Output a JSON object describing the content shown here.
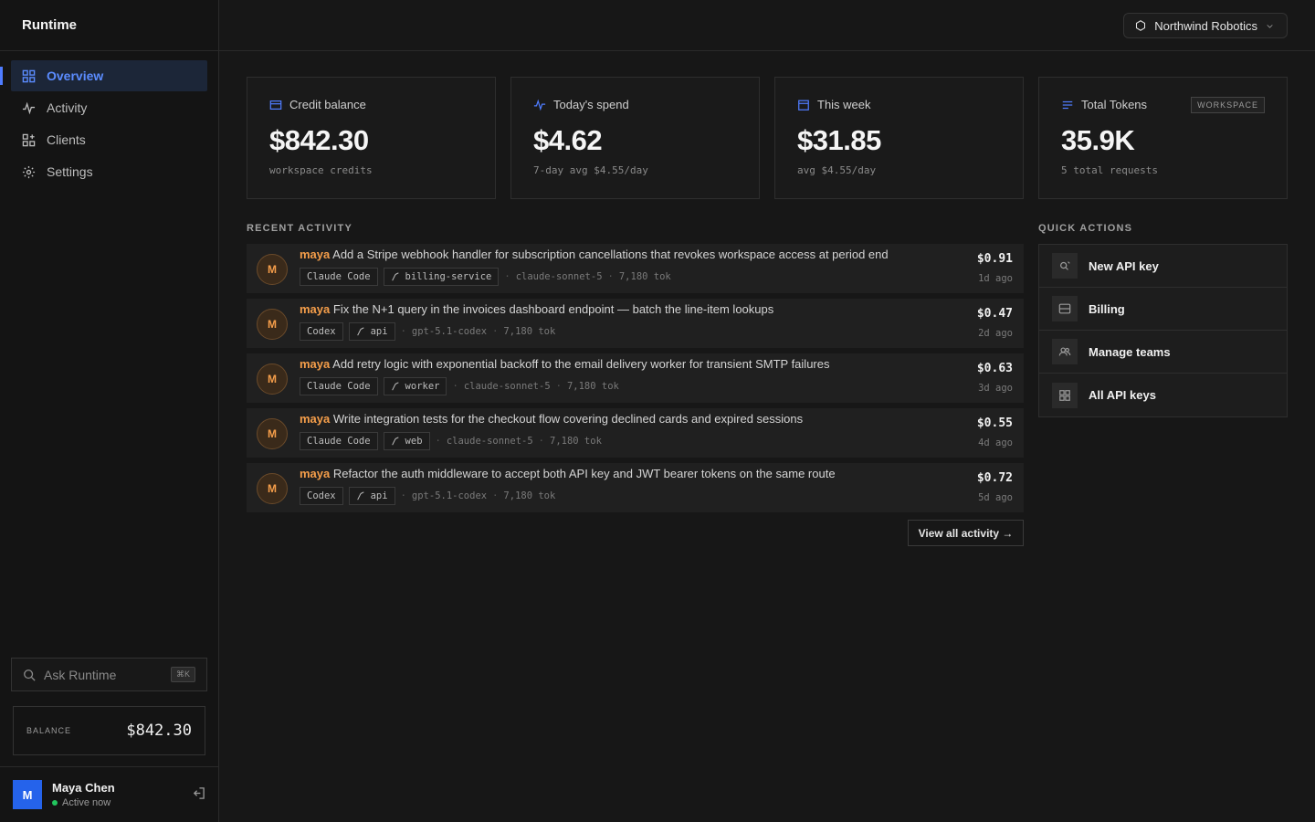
{
  "brand": "Runtime",
  "nav": [
    {
      "label": "Overview",
      "icon": "grid-icon",
      "active": true
    },
    {
      "label": "Activity",
      "icon": "pulse-icon",
      "active": false
    },
    {
      "label": "Clients",
      "icon": "apps-icon",
      "active": false
    },
    {
      "label": "Settings",
      "icon": "gear-icon",
      "active": false
    }
  ],
  "ask": {
    "label": "Ask Runtime",
    "shortcut": "⌘K"
  },
  "sidebar_balance": {
    "label": "BALANCE",
    "value": "$842.30"
  },
  "user": {
    "name": "Maya Chen",
    "initial": "M",
    "status": "Active now"
  },
  "org": {
    "name": "Northwind Robotics"
  },
  "cards": [
    {
      "title": "Credit balance",
      "value": "$842.30",
      "sub": "workspace credits"
    },
    {
      "title": "Today's spend",
      "value": "$4.62",
      "sub": "7-day avg $4.55/day"
    },
    {
      "title": "This week",
      "value": "$31.85",
      "sub": "avg $4.55/day"
    },
    {
      "title": "Total Tokens",
      "value": "35.9K",
      "sub": "5 total requests",
      "badge": "WORKSPACE"
    }
  ],
  "recent_activity_title": "RECENT ACTIVITY",
  "activity": [
    {
      "initial": "M",
      "user": "maya",
      "text": "Add a Stripe webhook handler for subscription cancellations that revokes workspace access at period end",
      "client": "Claude Code",
      "repo": "billing-service",
      "model": "claude-sonnet-5",
      "tokens": "7,180 tok",
      "cost": "$0.91",
      "ago": "1d ago"
    },
    {
      "initial": "M",
      "user": "maya",
      "text": "Fix the N+1 query in the invoices dashboard endpoint — batch the line-item lookups",
      "client": "Codex",
      "repo": "api",
      "model": "gpt-5.1-codex",
      "tokens": "7,180 tok",
      "cost": "$0.47",
      "ago": "2d ago"
    },
    {
      "initial": "M",
      "user": "maya",
      "text": "Add retry logic with exponential backoff to the email delivery worker for transient SMTP failures",
      "client": "Claude Code",
      "repo": "worker",
      "model": "claude-sonnet-5",
      "tokens": "7,180 tok",
      "cost": "$0.63",
      "ago": "3d ago"
    },
    {
      "initial": "M",
      "user": "maya",
      "text": "Write integration tests for the checkout flow covering declined cards and expired sessions",
      "client": "Claude Code",
      "repo": "web",
      "model": "claude-sonnet-5",
      "tokens": "7,180 tok",
      "cost": "$0.55",
      "ago": "4d ago"
    },
    {
      "initial": "M",
      "user": "maya",
      "text": "Refactor the auth middleware to accept both API key and JWT bearer tokens on the same route",
      "client": "Codex",
      "repo": "api",
      "model": "gpt-5.1-codex",
      "tokens": "7,180 tok",
      "cost": "$0.72",
      "ago": "5d ago"
    }
  ],
  "view_all": "View all activity →",
  "quick_actions_title": "QUICK ACTIONS",
  "quick_actions": [
    {
      "label": "New API key",
      "icon": "key-search-icon"
    },
    {
      "label": "Billing",
      "icon": "card-icon"
    },
    {
      "label": "Manage teams",
      "icon": "users-icon"
    },
    {
      "label": "All API keys",
      "icon": "grid-icon"
    }
  ],
  "colors": {
    "accent": "#4f7cff",
    "user_accent": "#f59e4a",
    "background": "#171717"
  }
}
